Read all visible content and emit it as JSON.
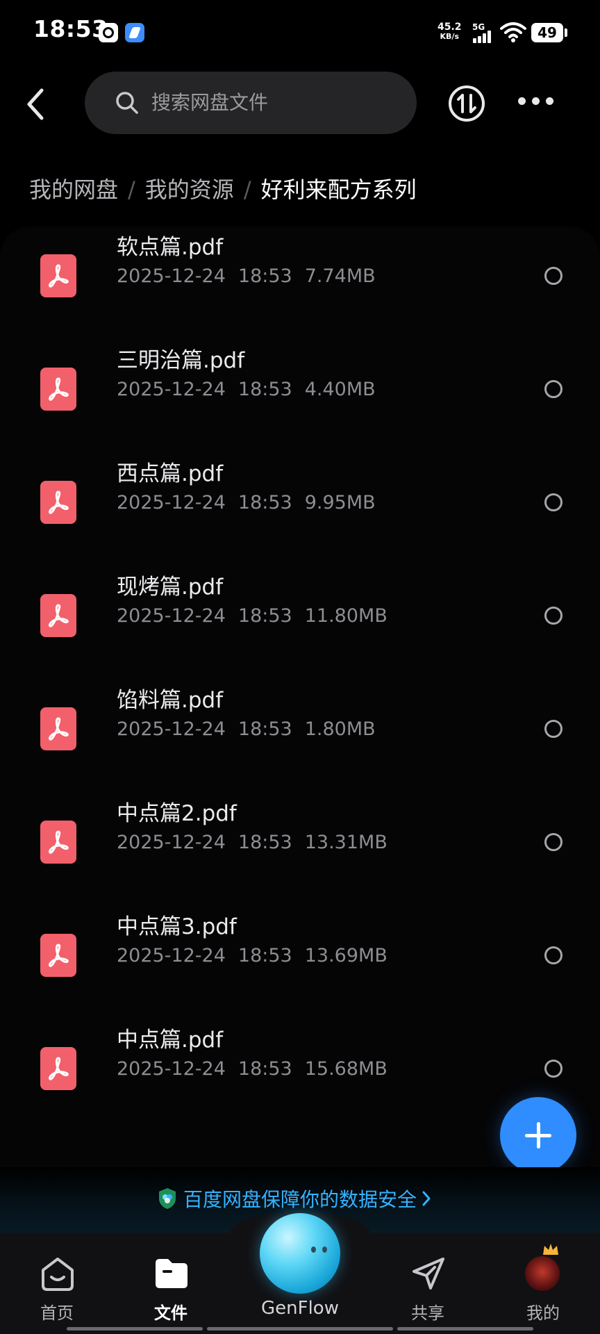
{
  "status_bar": {
    "time": "18:53",
    "net_speed_value": "45.2",
    "net_speed_unit": "KB/s",
    "signal_label": "5G",
    "battery": "49"
  },
  "search": {
    "placeholder": "搜索网盘文件"
  },
  "breadcrumb": {
    "items": [
      "我的网盘",
      "我的资源",
      "好利来配方系列"
    ],
    "separator": "/"
  },
  "files": [
    {
      "name": "软点篇.pdf",
      "date": "2025-12-24",
      "time": "18:53",
      "size": "7.74MB"
    },
    {
      "name": "三明治篇.pdf",
      "date": "2025-12-24",
      "time": "18:53",
      "size": "4.40MB"
    },
    {
      "name": "西点篇.pdf",
      "date": "2025-12-24",
      "time": "18:53",
      "size": "9.95MB"
    },
    {
      "name": "现烤篇.pdf",
      "date": "2025-12-24",
      "time": "18:53",
      "size": "11.80MB"
    },
    {
      "name": "馅料篇.pdf",
      "date": "2025-12-24",
      "time": "18:53",
      "size": "1.80MB"
    },
    {
      "name": "中点篇2.pdf",
      "date": "2025-12-24",
      "time": "18:53",
      "size": "13.31MB"
    },
    {
      "name": "中点篇3.pdf",
      "date": "2025-12-24",
      "time": "18:53",
      "size": "13.69MB"
    },
    {
      "name": "中点篇.pdf",
      "date": "2025-12-24",
      "time": "18:53",
      "size": "15.68MB"
    }
  ],
  "security_banner": {
    "text": "百度网盘保障你的数据安全"
  },
  "bottom_nav": {
    "home": "首页",
    "files": "文件",
    "genflow": "GenFlow",
    "share": "共享",
    "mine": "我的"
  },
  "colors": {
    "accent": "#2f8dff",
    "pdf_icon": "#f2606b",
    "banner_text": "#35b2ff"
  }
}
